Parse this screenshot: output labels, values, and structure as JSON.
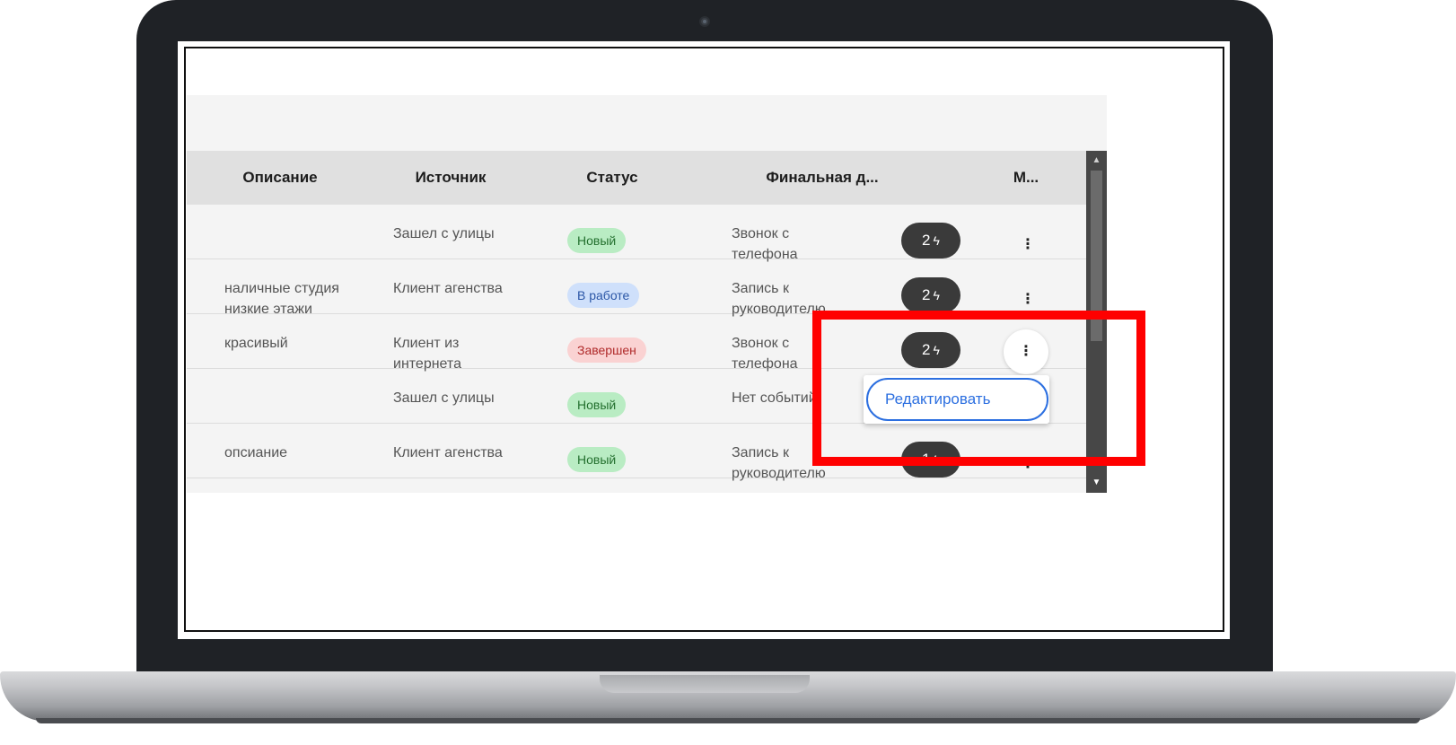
{
  "table": {
    "columns": {
      "description": "Описание",
      "source": "Источник",
      "status": "Статус",
      "final": "Финальная д...",
      "more": "М..."
    },
    "rows": [
      {
        "description": "",
        "source": "Зашел с улицы",
        "status": "Новый",
        "final": "Звонок с\nтелефона",
        "events": "2",
        "kebab": "⋮"
      },
      {
        "description": "наличные студия\nнизкие этажи",
        "source": "Клиент агенства",
        "status": "В работе",
        "final": "Запись к\nруководителю",
        "events": "2",
        "kebab": "⋮"
      },
      {
        "description": "красивый",
        "source": "Клиент из\nинтернета",
        "status": "Завершен",
        "final": "Звонок с\nтелефона",
        "events": "2",
        "kebab": "⋮"
      },
      {
        "description": "",
        "source": "Зашел с улицы",
        "status": "Новый",
        "final": "Нет событий",
        "events": "",
        "kebab": ""
      },
      {
        "description": "опсиание",
        "source": "Клиент агенства",
        "status": "Новый",
        "final": "Запись к\nруководителю",
        "events": "1",
        "kebab": "⋮"
      }
    ]
  },
  "context_menu": {
    "edit_label": "Редактировать"
  },
  "icons": {
    "events": "bolt-icon",
    "more": "kebab-icon"
  },
  "colors": {
    "badge_new": "#b9ecc3",
    "badge_work": "#cfe0fb",
    "badge_done": "#fad2d2",
    "accent": "#2c6fe0",
    "highlight": "#ff0000"
  }
}
